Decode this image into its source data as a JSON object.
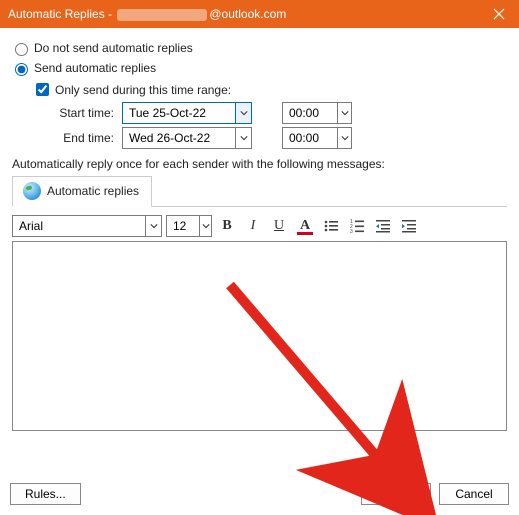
{
  "titlebar": {
    "prefix": "Automatic Replies - ",
    "suffix": "@outlook.com"
  },
  "radio": {
    "do_not_send": "Do not send automatic replies",
    "send_auto": "Send automatic replies"
  },
  "only_send_range": "Only send during this time range:",
  "start": {
    "label": "Start time:",
    "date": "Tue 25-Oct-22",
    "time": "00:00"
  },
  "end": {
    "label": "End time:",
    "date": "Wed 26-Oct-22",
    "time": "00:00"
  },
  "instruction": "Automatically reply once for each sender with the following messages:",
  "tab": {
    "label": "Automatic replies"
  },
  "fonts": {
    "family": "Arial",
    "size": "12"
  },
  "buttons": {
    "rules": "Rules...",
    "ok": "OK",
    "cancel": "Cancel"
  }
}
